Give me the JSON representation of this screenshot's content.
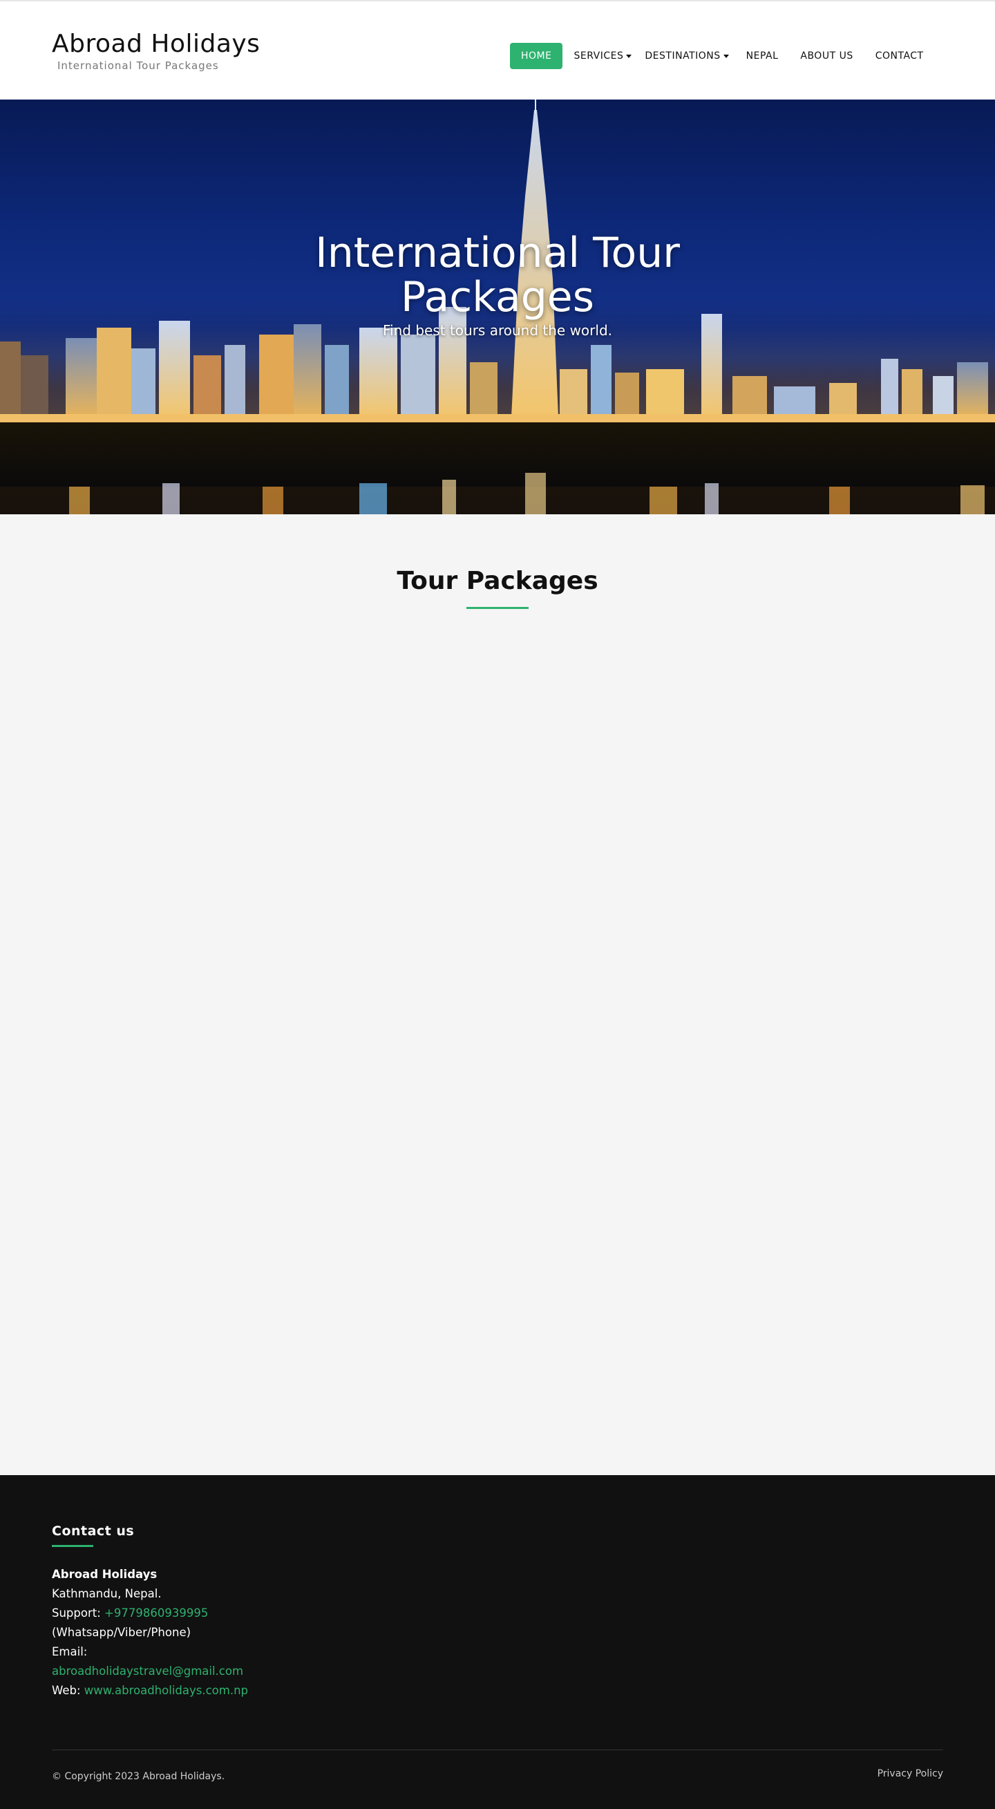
{
  "header": {
    "brand_title": "Abroad Holidays",
    "brand_subtitle": "International Tour Packages",
    "nav": {
      "home": "HOME",
      "services": "SERVICES",
      "destinations": "DESTINATIONS",
      "nepal": "NEPAL",
      "about": "ABOUT US",
      "contact": "CONTACT"
    }
  },
  "hero": {
    "title_line1": "International Tour",
    "title_line2": "Packages",
    "subtitle": "Find best tours around the world."
  },
  "packages": {
    "title": "Tour Packages"
  },
  "footer": {
    "heading": "Contact us",
    "company": "Abroad Holidays",
    "address": "Kathmandu, Nepal.",
    "support_label": "Support: ",
    "support_phone": "+9779860939995",
    "support_note": "(Whatsapp/Viber/Phone)",
    "email_label": "Email:",
    "email": "abroadholidaystravel@gmail.com",
    "web_label": "Web: ",
    "web": "www.abroadholidays.com.np",
    "copyright": "© Copyright 2023 Abroad Holidays.",
    "privacy": "Privacy Policy"
  },
  "colors": {
    "accent": "#2eb26f",
    "footer_bg": "#111111",
    "section_bg": "#f5f5f5"
  },
  "icons": {
    "dropdown": "caret-down-icon"
  }
}
